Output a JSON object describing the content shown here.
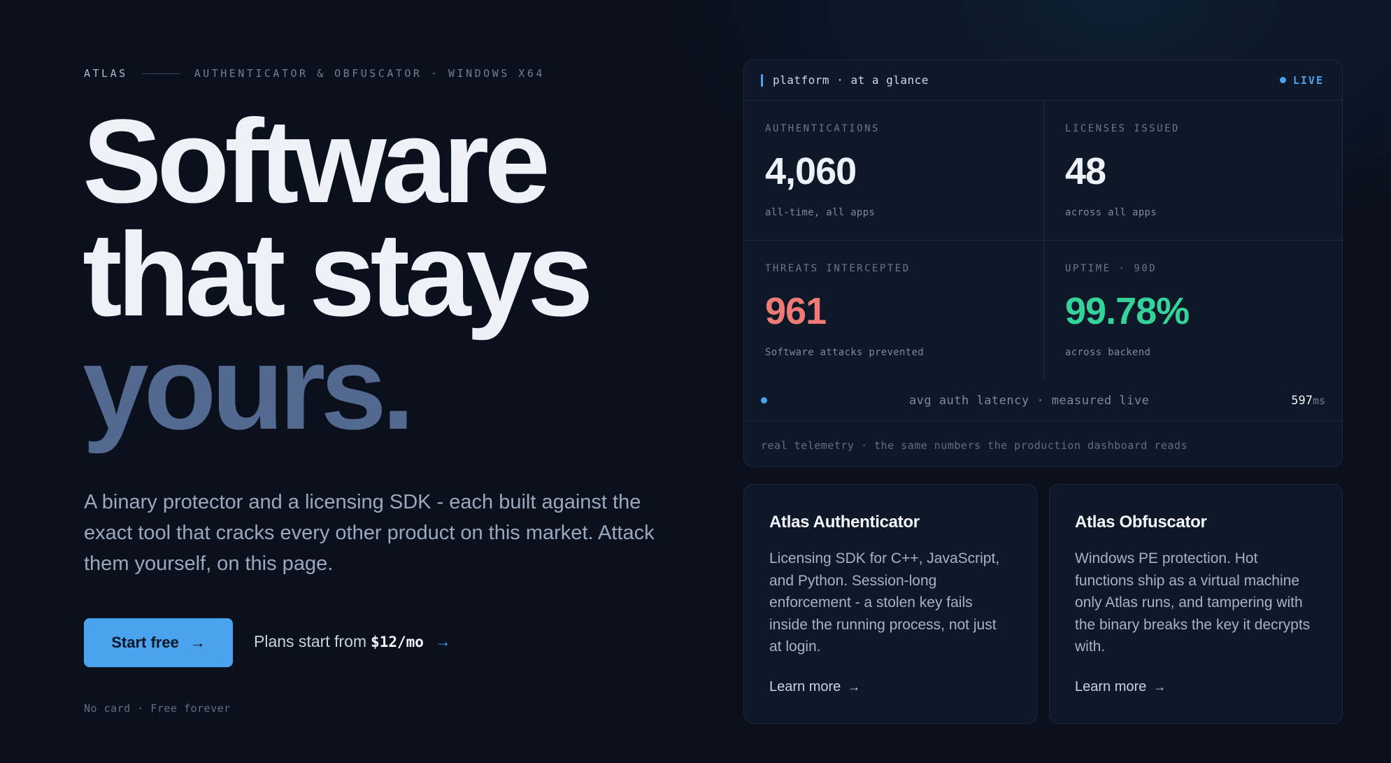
{
  "eyebrow": {
    "brand": "ATLAS",
    "tagline": "AUTHENTICATOR & OBFUSCATOR · WINDOWS X64"
  },
  "headline": {
    "line1": "Software",
    "line2": "that stays",
    "line3": "yours."
  },
  "lede": "A binary protector and a licensing SDK - each built against the exact tool that cracks every other product on this market. Attack them yourself, on this page.",
  "cta": {
    "label": "Start free",
    "arrow": "→",
    "plans_prefix": "Plans start from",
    "plans_price": "$12/mo",
    "plans_arrow": "→",
    "fine_print": "No card · Free forever"
  },
  "panel": {
    "title": "platform · at a glance",
    "status": "LIVE",
    "stats": [
      {
        "label": "AUTHENTICATIONS",
        "value": "4,060",
        "sub": "all-time, all apps"
      },
      {
        "label": "LICENSES ISSUED",
        "value": "48",
        "sub": "across all apps"
      },
      {
        "label": "THREATS INTERCEPTED",
        "value": "961",
        "sub": "Software attacks prevented"
      },
      {
        "label": "UPTIME · 90D",
        "value": "99.78%",
        "sub": "across backend"
      }
    ],
    "latency": {
      "label": "avg auth latency · measured live",
      "value": "597",
      "unit": "ms"
    },
    "footer": "real telemetry · the same numbers the production dashboard reads"
  },
  "products": [
    {
      "title": "Atlas Authenticator",
      "description": "Licensing SDK for C++, JavaScript, and Python. Session-long enforcement - a stolen key fails inside the running process, not just at login.",
      "link": "Learn more",
      "arrow": "→"
    },
    {
      "title": "Atlas Obfuscator",
      "description": "Windows PE protection. Hot functions ship as a virtual machine only Atlas runs, and tampering with the binary breaks the key it decrypts with.",
      "link": "Learn more",
      "arrow": "→"
    }
  ],
  "colors": {
    "background": "#0a111d",
    "accent": "#4ba3ed",
    "threat": "#ef7b76",
    "uptime": "#34d399",
    "headline_muted": "#53698f"
  }
}
